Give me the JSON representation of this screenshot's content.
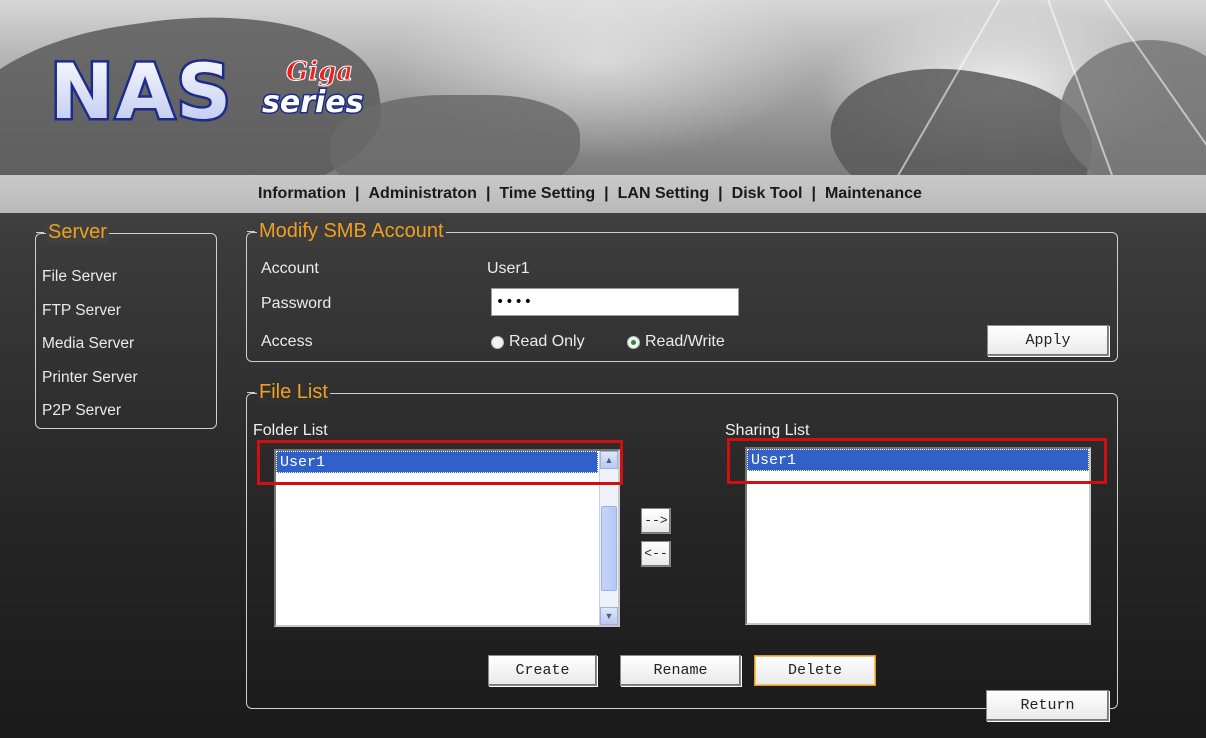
{
  "header": {
    "logo_main": "NAS",
    "logo_sub_top": "Giga",
    "logo_sub_bottom": "series"
  },
  "nav": {
    "items": [
      "Information",
      "Administraton",
      "Time Setting",
      "LAN Setting",
      "Disk Tool",
      "Maintenance"
    ],
    "separator": "|"
  },
  "sidebar": {
    "title": "Server",
    "items": [
      "File Server",
      "FTP Server",
      "Media Server",
      "Printer Server",
      "P2P Server"
    ]
  },
  "smb": {
    "title": "Modify SMB Account",
    "account_label": "Account",
    "account_value": "User1",
    "password_label": "Password",
    "password_value": "••••",
    "access_label": "Access",
    "access_options": [
      "Read Only",
      "Read/Write"
    ],
    "access_selected": "Read/Write",
    "apply_label": "Apply"
  },
  "file_list": {
    "title": "File List",
    "folder_list_label": "Folder List",
    "folder_items": [
      "User1"
    ],
    "sharing_list_label": "Sharing List",
    "sharing_items": [
      "User1"
    ],
    "add_arrow": "-->",
    "remove_arrow": "<--",
    "create_label": "Create",
    "rename_label": "Rename",
    "delete_label": "Delete",
    "return_label": "Return"
  },
  "colors": {
    "legend_orange": "#f0a020",
    "selection_blue": "#3161c8",
    "highlight_red": "#d01010"
  }
}
